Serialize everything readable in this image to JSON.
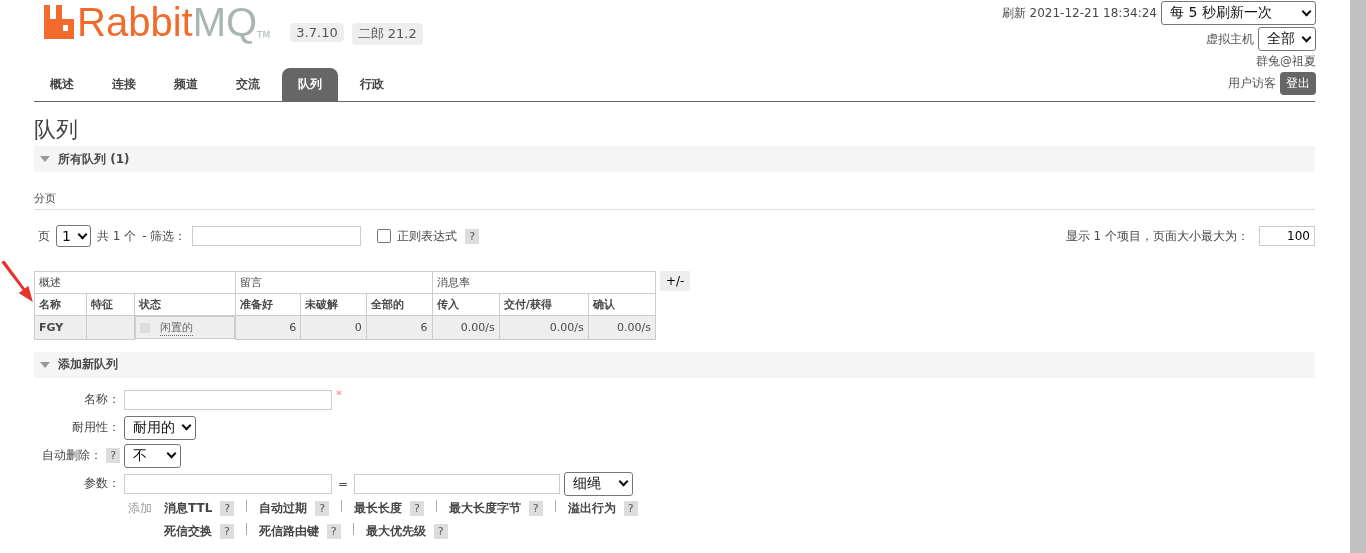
{
  "header": {
    "logo": {
      "part_1": "Rabbit",
      "part_2": "MQ",
      "trademark": "TM"
    },
    "badges": [
      "3.7.10",
      "二郎 21.2"
    ],
    "refresh": {
      "label": "刷新 2021-12-21 18:34:24",
      "value": "每 5 秒刷新一次"
    },
    "vhost": {
      "label": "虚拟主机",
      "value": "全部"
    },
    "cluster": "群兔@祖夏",
    "user": {
      "label": "用户访客",
      "logout": "登出"
    }
  },
  "tabs": [
    {
      "label": "概述",
      "selected": false
    },
    {
      "label": "连接",
      "selected": false
    },
    {
      "label": "频道",
      "selected": false
    },
    {
      "label": "交流",
      "selected": false
    },
    {
      "label": "队列",
      "selected": true
    },
    {
      "label": "行政",
      "selected": false
    }
  ],
  "page_title": "队列",
  "all_queues": {
    "title": "所有队列 (1)",
    "expanded": true
  },
  "pagination": {
    "title": "分页",
    "page_label": "页",
    "page_value": "1",
    "total": "共 1 个",
    "filter_label": "- 筛选：",
    "regex": {
      "label": "正则表达式",
      "checked": false
    },
    "help": "?",
    "summary": "显示 1 个项目，页面大小最大为：",
    "page_size": "100"
  },
  "table": {
    "groups": [
      {
        "label": "概述",
        "columns": [
          "名称",
          "特征",
          "状态"
        ]
      },
      {
        "label": "留言",
        "columns": [
          "准备好",
          "未破解",
          "全部的"
        ]
      },
      {
        "label": "消息率",
        "columns": [
          "传入",
          "交付/获得",
          "确认"
        ]
      }
    ],
    "toggle": "+/-",
    "rows": [
      {
        "name": "FGY",
        "state": "闲置的",
        "ready": "6",
        "unacked": "0",
        "total": "6",
        "incoming": "0.00/s",
        "deliver": "0.00/s",
        "ack": "0.00/s"
      }
    ]
  },
  "add_queue": {
    "title": "添加新队列",
    "expanded": true,
    "name": {
      "label": "名称：",
      "required": "*"
    },
    "durability": {
      "label": "耐用性：",
      "value": "耐用的"
    },
    "auto_delete": {
      "label": "自动删除：",
      "help": "?",
      "value": "不"
    },
    "arguments": {
      "label": "参数：",
      "equals": "=",
      "type": "细绳",
      "add_label": "添加"
    },
    "argument_shortcuts": [
      [
        {
          "label": "消息TTL",
          "help": "?"
        },
        {
          "label": "自动过期",
          "help": "?"
        },
        {
          "label": "最长长度",
          "help": "?"
        },
        {
          "label": "最大长度字节",
          "help": "?"
        },
        {
          "label": "溢出行为",
          "help": "?"
        }
      ],
      [
        {
          "label": "死信交换",
          "help": "?"
        },
        {
          "label": "死信路由键",
          "help": "?"
        },
        {
          "label": "最大优先级",
          "help": "?"
        }
      ]
    ]
  }
}
